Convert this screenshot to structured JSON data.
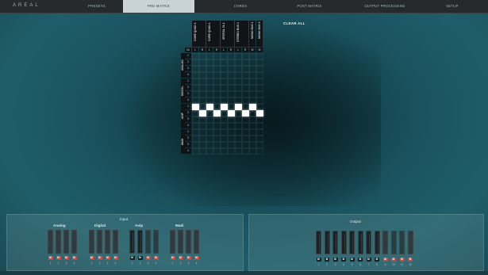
{
  "app": {
    "logo": "AREAL"
  },
  "nav": {
    "tabs": [
      "PRESETS",
      "PRE MATRIX",
      "CORES",
      "POST MATRIX",
      "OUTPUT PROCESSING",
      "SETUP"
    ],
    "active": "PRE MATRIX"
  },
  "matrix": {
    "columns": [
      "CORE QUAD 1",
      "CORE QUAD 1",
      "SPATIAL 31-1",
      "STEREO BUS 1",
      "MONO BUS 1",
      "MONO BUS 2"
    ],
    "lr_labels": [
      "L",
      "R",
      "L",
      "R",
      "L",
      "R",
      "L",
      "R",
      "M",
      "M"
    ],
    "ch_label": "Ch",
    "groups": [
      {
        "name": "ANALOG",
        "rows": [
          "1",
          "2",
          "3",
          "4"
        ]
      },
      {
        "name": "DIGITAL",
        "rows": [
          "1",
          "2",
          "3",
          "4"
        ]
      },
      {
        "name": "AOIP",
        "rows": [
          "1",
          "2",
          "3",
          "4"
        ]
      },
      {
        "name": "MADI",
        "rows": [
          "1",
          "2",
          "3",
          "4"
        ]
      }
    ],
    "active_cells": [
      [
        8,
        0
      ],
      [
        9,
        1
      ],
      [
        8,
        2
      ],
      [
        9,
        3
      ],
      [
        8,
        4
      ],
      [
        9,
        5
      ],
      [
        8,
        6
      ],
      [
        9,
        7
      ],
      [
        8,
        8
      ],
      [
        9,
        9
      ]
    ],
    "clear_label": "CLEAR ALL"
  },
  "input": {
    "title": "Input",
    "groups": [
      {
        "name": "Analog",
        "mutes": [
          "M",
          "M",
          "M",
          "M"
        ],
        "muted": [
          true,
          true,
          true,
          true
        ],
        "nums": [
          "1",
          "2",
          "3",
          "4"
        ]
      },
      {
        "name": "Digital",
        "mutes": [
          "M",
          "M",
          "M",
          "M"
        ],
        "muted": [
          true,
          true,
          true,
          true
        ],
        "nums": [
          "1",
          "2",
          "3",
          "4"
        ]
      },
      {
        "name": "Aoip",
        "mutes": [
          "M",
          "M",
          "M",
          "M"
        ],
        "muted": [
          false,
          false,
          true,
          true
        ],
        "nums": [
          "1",
          "2",
          "3",
          "4"
        ]
      },
      {
        "name": "Madi",
        "mutes": [
          "M",
          "M",
          "M",
          "M"
        ],
        "muted": [
          true,
          true,
          true,
          true
        ],
        "nums": [
          "1",
          "2",
          "3",
          "4"
        ]
      }
    ]
  },
  "output": {
    "title": "Output",
    "mutes": [
      "M",
      "M",
      "M",
      "M",
      "M",
      "M",
      "M",
      "M",
      "M",
      "M",
      "M",
      "M"
    ],
    "muted": [
      false,
      false,
      false,
      false,
      false,
      false,
      false,
      false,
      true,
      true,
      true,
      true
    ],
    "nums": [
      "1",
      "2",
      "3",
      "4",
      "5",
      "6",
      "7",
      "8",
      "9",
      "10",
      "11",
      "12"
    ]
  },
  "colors": {
    "accent": "#c24a40",
    "active_tab": "#c9d3d6",
    "background": "#1a5460"
  }
}
